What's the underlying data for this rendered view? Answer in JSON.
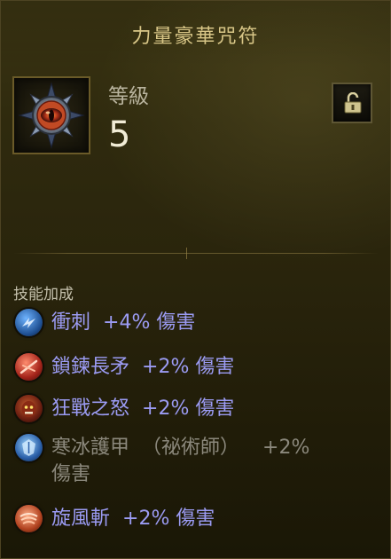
{
  "item": {
    "title": "力量豪華咒符",
    "level_label": "等級",
    "level_value": "5",
    "gem_icon": "gem-icon",
    "lock_icon": "unlocked-padlock-icon"
  },
  "bonuses": {
    "section_label": "技能加成",
    "skills": [
      {
        "name": "衝刺",
        "bonus": "+4% 傷害",
        "icon": "charge-icon",
        "active": true
      },
      {
        "name": "鎖鍊長矛",
        "bonus": "+2% 傷害",
        "icon": "chain-spear-icon",
        "active": true
      },
      {
        "name": "狂戰之怒",
        "bonus": "+2% 傷害",
        "icon": "berserker-rage-icon",
        "active": true
      },
      {
        "name": "寒冰護甲",
        "class_note": "（祕術師）",
        "bonus": "+2%",
        "bonus_wrap": "傷害",
        "icon": "frost-armor-icon",
        "active": false
      },
      {
        "name": "旋風斬",
        "bonus": "+2% 傷害",
        "icon": "whirlwind-icon",
        "active": true
      }
    ]
  },
  "colors": {
    "title": "#d8c687",
    "active_skill": "#9b9bf3",
    "inactive_skill": "#8b887c",
    "panel": "#2f2a0e"
  }
}
